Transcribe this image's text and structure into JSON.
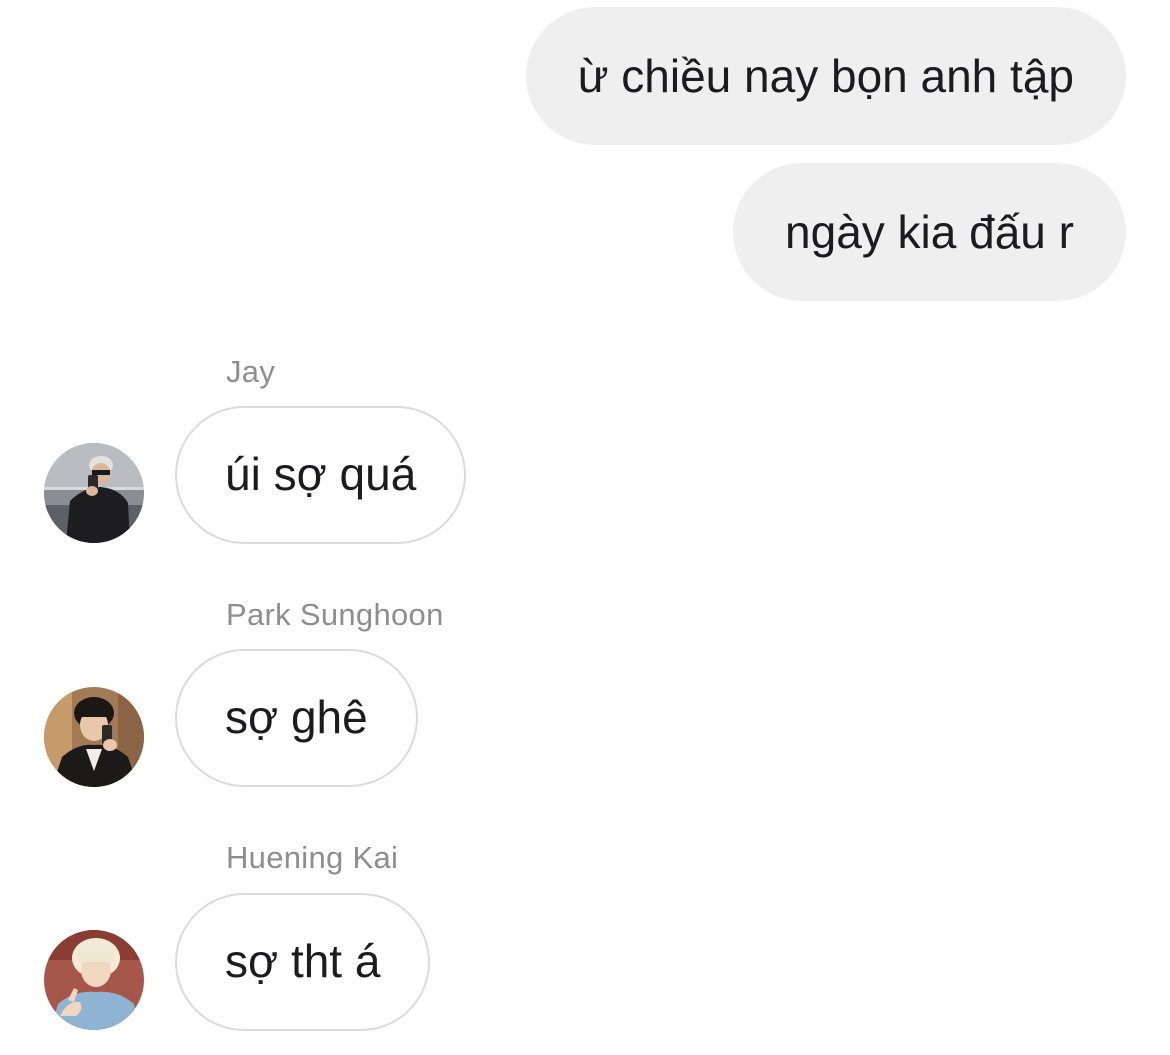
{
  "outgoing": [
    {
      "text": "ừ chiều nay bọn anh tập"
    },
    {
      "text": "ngày kia đấu r"
    }
  ],
  "incoming": [
    {
      "sender": "Jay",
      "text": "úi sợ quá",
      "avatar_icon": "profile-photo-jay"
    },
    {
      "sender": "Park Sunghoon",
      "text": "sợ ghê",
      "avatar_icon": "profile-photo-sunghoon"
    },
    {
      "sender": "Huening Kai",
      "text": "sợ tht á",
      "avatar_icon": "profile-photo-huening-kai"
    }
  ],
  "colors": {
    "outgoing_bubble": "#efefef",
    "incoming_border": "#dbdbdb",
    "sender_name": "#8e8e8e",
    "text": "#1c1c1e"
  }
}
